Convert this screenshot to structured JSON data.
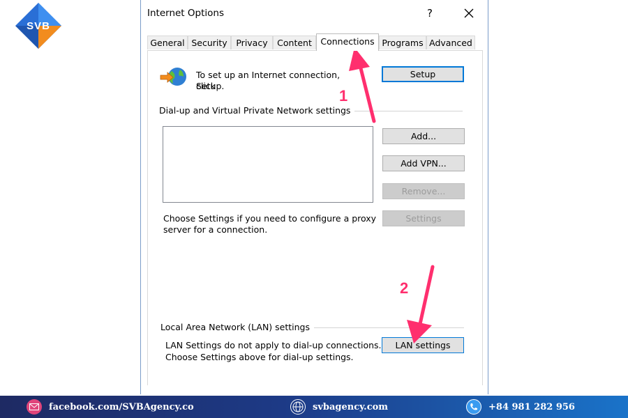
{
  "brand": {
    "logo_text": "SVB"
  },
  "window": {
    "title": "Internet Options",
    "help_label": "?"
  },
  "tabs": [
    {
      "label": "General"
    },
    {
      "label": "Security"
    },
    {
      "label": "Privacy"
    },
    {
      "label": "Content"
    },
    {
      "label": "Connections",
      "active": true
    },
    {
      "label": "Programs"
    },
    {
      "label": "Advanced"
    }
  ],
  "connections": {
    "setup_text_line1": "To set up an Internet connection, click",
    "setup_text_line2": "Setup.",
    "setup_button": "Setup",
    "dialup_section": "Dial-up and Virtual Private Network settings",
    "add_button": "Add...",
    "add_vpn_button": "Add VPN...",
    "remove_button": "Remove...",
    "settings_button": "Settings",
    "proxy_text_line1": "Choose Settings if you need to configure a proxy",
    "proxy_text_line2": "server for a connection.",
    "lan_section": "Local Area Network (LAN) settings",
    "lan_text_line1": "LAN Settings do not apply to dial-up connections.",
    "lan_text_line2": "Choose Settings above for dial-up settings.",
    "lan_button": "LAN settings"
  },
  "annotations": {
    "step1": "1",
    "step2": "2",
    "color": "#ff2f6e"
  },
  "footer": {
    "facebook": "facebook.com/SVBAgency.co",
    "website": "svbagency.com",
    "phone": "+84 981 282 956"
  }
}
